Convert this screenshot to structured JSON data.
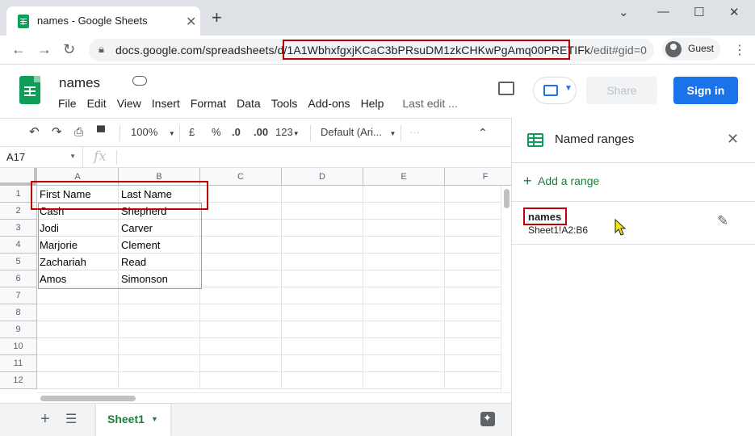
{
  "browser": {
    "tab_title": "names - Google Sheets",
    "tab_close": "✕",
    "new_tab": "+",
    "url_host": "docs.google.com/spreadsheets/d/",
    "url_id": "1A1WbhxfgxjKCaC3bPRsuDM1zkCHKwPgAmq00PRETIFk",
    "url_tail": "/edit#gid=0",
    "profile_label": "Guest",
    "icons": [
      "back-icon",
      "forward-icon",
      "reload-icon",
      "lock-icon",
      "kebab-icon"
    ]
  },
  "doc": {
    "title": "names",
    "menu": [
      "File",
      "Edit",
      "View",
      "Insert",
      "Format",
      "Data",
      "Tools",
      "Add-ons",
      "Help"
    ],
    "last_edit": "Last edit ...",
    "share_label": "Share",
    "signin_label": "Sign in"
  },
  "toolbar": {
    "zoom": "100%",
    "currency": "£",
    "percent": "%",
    "dec_decrease": ".0",
    "dec_increase": ".00",
    "format_more": "123",
    "font": "Default (Ari...",
    "more": "···"
  },
  "formula_bar": {
    "cell_ref": "A17",
    "fx": "fx"
  },
  "grid": {
    "columns": [
      "A",
      "B",
      "C",
      "D",
      "E",
      "F"
    ],
    "rows": [
      "1",
      "2",
      "3",
      "4",
      "5",
      "6",
      "7",
      "8",
      "9",
      "10",
      "11",
      "12"
    ],
    "cells": [
      [
        "First Name",
        "Last Name"
      ],
      [
        "Cash",
        "Shepherd"
      ],
      [
        "Jodi",
        "Carver"
      ],
      [
        "Marjorie",
        "Clement"
      ],
      [
        "Zachariah",
        "Read"
      ],
      [
        "Amos",
        "Simonson"
      ]
    ]
  },
  "sheets": {
    "active": "Sheet1"
  },
  "panel": {
    "title": "Named ranges",
    "add_label": "Add a range",
    "ranges": [
      {
        "name": "names",
        "ref": "Sheet1!A2:B6"
      }
    ]
  },
  "colors": {
    "accent": "#1a73e8",
    "sheets_green": "#0f9d58",
    "highlight_red": "#c00000",
    "range_border": "#77b76a"
  }
}
